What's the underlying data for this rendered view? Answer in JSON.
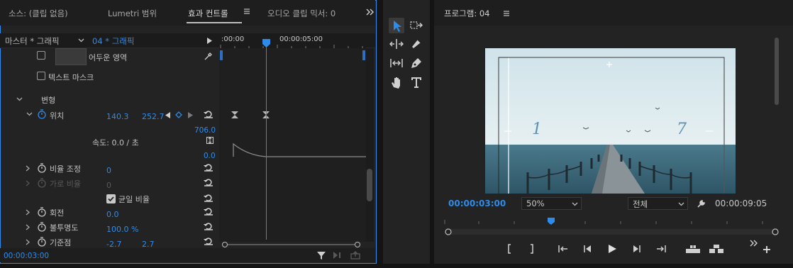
{
  "effect_controls": {
    "tabs": [
      {
        "label": "소스: (클립 없음)"
      },
      {
        "label": "Lumetri 범위"
      },
      {
        "label": "효과 컨트롤"
      },
      {
        "label": "오디오 클립 믹서: 0"
      }
    ],
    "more_icon": "double-chevron-right-icon",
    "header": {
      "master_label": "마스터 * 그래픽",
      "sequence_label": "04 * 그래픽"
    },
    "ruler": {
      "start_tc": ":00:00",
      "mid_tc": "00:00:05:00"
    },
    "rows": {
      "darken_label": "어두운 영역",
      "text_mask_label": "텍스트 마스크",
      "transform_label": "변형",
      "position_label": "위치",
      "position_x": "140.3",
      "position_y": "252.7",
      "graph_max": "706.0",
      "speed_label": "속도: 0.0 / 초",
      "graph_min": "0.0",
      "scale_label": "비율 조정",
      "scale_value": "0",
      "scale_width_label": "가로 비율",
      "scale_width_value": "0",
      "uniform_scale_label": "균일 비율",
      "rotation_label": "회전",
      "rotation_value": "0.0",
      "opacity_label": "불투명도",
      "opacity_value": "100.0 %",
      "anchor_label": "기준점",
      "anchor_x": "-2.7",
      "anchor_y": "2.7"
    },
    "current_time": "00:00:03:00"
  },
  "program_monitor": {
    "title": "프로그램: 04",
    "overlay_left": "1",
    "overlay_right": "7",
    "current_time": "00:00:03:00",
    "zoom": "50%",
    "quality": "전체",
    "duration": "00:00:09:05"
  },
  "colors": {
    "accent": "#2d8ceb",
    "panel": "#232323"
  }
}
